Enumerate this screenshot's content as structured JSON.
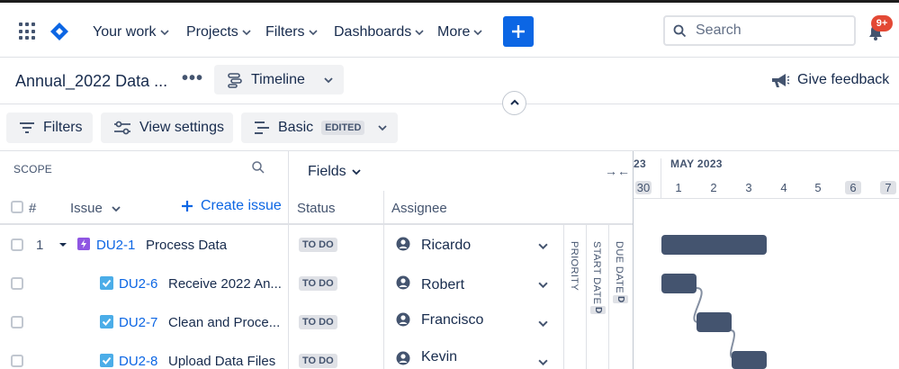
{
  "topnav": {
    "items": [
      "Your work",
      "Projects",
      "Filters",
      "Dashboards",
      "More"
    ],
    "search_placeholder": "Search",
    "notification_count": "9+"
  },
  "header": {
    "title": "Annual_2022 Data ...",
    "view_label": "Timeline",
    "feedback_label": "Give feedback"
  },
  "toolbar": {
    "filters_label": "Filters",
    "view_settings_label": "View settings",
    "basic_label": "Basic",
    "edited_label": "EDITED"
  },
  "table": {
    "scope_label": "SCOPE",
    "fields_label": "Fields",
    "hash_label": "#",
    "issue_label": "Issue",
    "create_issue_label": "Create issue",
    "status_label": "Status",
    "assignee_label": "Assignee",
    "priority_label": "PRIORITY",
    "start_date_label": "START DATE",
    "due_date_label": "DUE DATE",
    "date_badge": "D",
    "rows": [
      {
        "num": "1",
        "key": "DU2-1",
        "summary": "Process Data",
        "status": "TO DO",
        "assignee": "Ricardo",
        "type": "epic"
      },
      {
        "num": "",
        "key": "DU2-6",
        "summary": "Receive 2022 An...",
        "status": "TO DO",
        "assignee": "Robert",
        "type": "task"
      },
      {
        "num": "",
        "key": "DU2-7",
        "summary": "Clean and Proce...",
        "status": "TO DO",
        "assignee": "Francisco",
        "type": "task"
      },
      {
        "num": "",
        "key": "DU2-8",
        "summary": "Upload Data Files",
        "status": "TO DO",
        "assignee": "Kevin",
        "type": "task"
      }
    ]
  },
  "timeline": {
    "prev_month_fragment": "23",
    "month_label": "MAY 2023",
    "days": [
      "30",
      "1",
      "2",
      "3",
      "4",
      "5",
      "6",
      "7"
    ]
  },
  "colors": {
    "accent": "#0c66e4",
    "bar": "#44546f",
    "epic": "#8f56e2",
    "task": "#4bade8",
    "badge": "#e34935"
  }
}
